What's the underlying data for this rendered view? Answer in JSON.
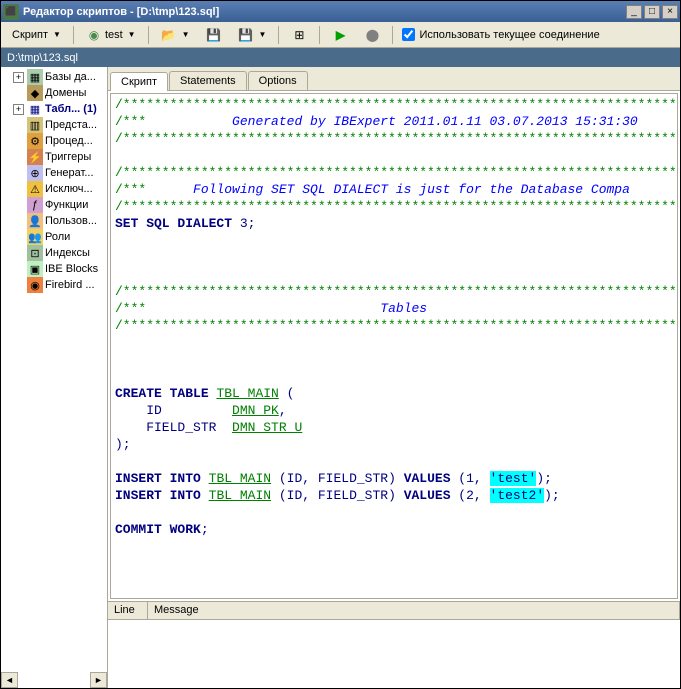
{
  "window": {
    "title": "Редактор скриптов - [D:\\tmp\\123.sql]"
  },
  "toolbar": {
    "script_label": "Скрипт",
    "test_label": "test",
    "checkbox_label": "Использовать текущее соединение",
    "checkbox_checked": true
  },
  "pathbar": {
    "text": "D:\\tmp\\123.sql"
  },
  "sidebar": {
    "items": [
      {
        "label": "Базы да...",
        "expandable": true,
        "icon": "db"
      },
      {
        "label": "Домены",
        "expandable": false,
        "icon": "dm"
      },
      {
        "label": "Табл... (1)",
        "expandable": true,
        "icon": "tb",
        "selected": true
      },
      {
        "label": "Предста...",
        "expandable": false,
        "icon": "vw"
      },
      {
        "label": "Процед...",
        "expandable": false,
        "icon": "pr"
      },
      {
        "label": "Триггеры",
        "expandable": false,
        "icon": "tr"
      },
      {
        "label": "Генерат...",
        "expandable": false,
        "icon": "gn"
      },
      {
        "label": "Исключ...",
        "expandable": false,
        "icon": "ex"
      },
      {
        "label": "Функции",
        "expandable": false,
        "icon": "fn"
      },
      {
        "label": "Пользов...",
        "expandable": false,
        "icon": "us"
      },
      {
        "label": "Роли",
        "expandable": false,
        "icon": "rl"
      },
      {
        "label": "Индексы",
        "expandable": false,
        "icon": "ix"
      },
      {
        "label": "IBE Blocks",
        "expandable": false,
        "icon": "ib"
      },
      {
        "label": "Firebird ...",
        "expandable": false,
        "icon": "fb"
      }
    ]
  },
  "tabs": [
    {
      "label": "Скрипт",
      "active": true
    },
    {
      "label": "Statements",
      "active": false
    },
    {
      "label": "Options",
      "active": false
    }
  ],
  "code": {
    "line1": "/****************************************************************************",
    "line2a": "/***",
    "line2b": "Generated by IBExpert 2011.01.11 03.07.2013 15:31:30",
    "line3": "/****************************************************************************",
    "line4": "",
    "line5": "/****************************************************************************",
    "line6a": "/***",
    "line6b": "Following SET SQL DIALECT is just for the Database Compa",
    "line7": "/****************************************************************************",
    "set_dialect_kw": "SET SQL DIALECT",
    "set_dialect_val": " 3;",
    "line_blank": "",
    "line11": "/****************************************************************************",
    "line12a": "/***",
    "line12b": "Tables",
    "line13": "/****************************************************************************",
    "create_kw": "CREATE TABLE",
    "tbl_main": "TBL_MAIN",
    "open_paren": " (",
    "id_field": "    ID         ",
    "dmn_pk": "DMN_PK",
    "comma": ",",
    "field_str": "    FIELD_STR  ",
    "dmn_str_u": "DMN_STR_U",
    "close_paren": ");",
    "insert_kw": "INSERT INTO",
    "insert1_mid": " (ID, FIELD_STR) ",
    "values_kw": "VALUES",
    "insert1_vals": " (1, ",
    "test1_lit": "'test'",
    "insert1_end": ");",
    "insert2_vals": " (2, ",
    "test2_lit": "'test2'",
    "insert2_end": ");",
    "commit_kw": "COMMIT WORK",
    "commit_end": ";"
  },
  "messages": {
    "col_line": "Line",
    "col_message": "Message"
  }
}
